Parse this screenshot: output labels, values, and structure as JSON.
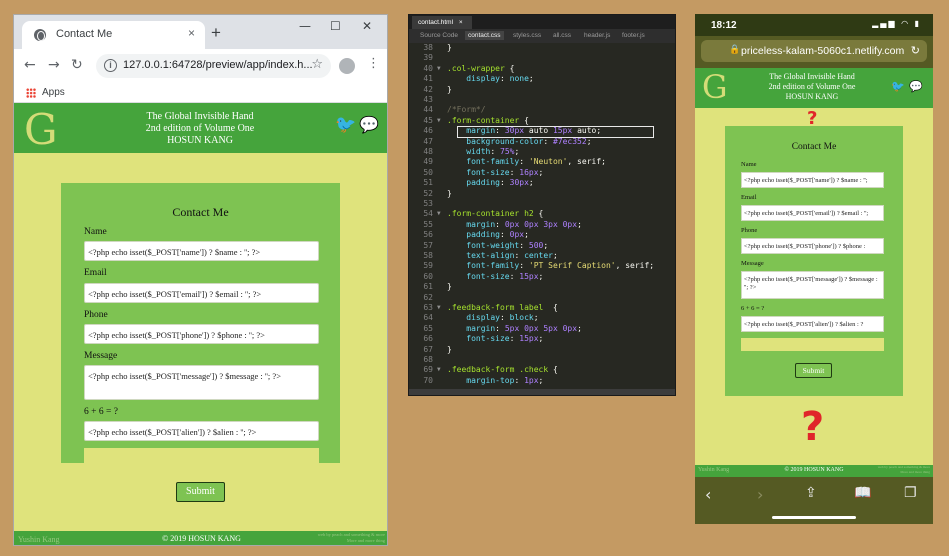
{
  "browser": {
    "tab_title": "Contact Me",
    "tab_close": "×",
    "new_tab": "+",
    "window_controls": [
      "—",
      "☐",
      "✕"
    ],
    "url": "127.0.0.1:64728/preview/app/index.h...",
    "bookmarks_label": "Apps",
    "icons": [
      "globe-icon",
      "back-icon",
      "forward-icon",
      "reload-icon",
      "info-icon",
      "star-icon",
      "avatar-icon",
      "menu-icon",
      "apps-icon"
    ]
  },
  "site": {
    "title_line1": "The Global Invisible Hand",
    "title_line2": "2nd edition of Volume One",
    "title_line3": "HOSUN KANG",
    "logo_letter": "G",
    "form_title": "Contact Me",
    "fields": [
      {
        "label": "Name",
        "value": "<?php echo isset($_POST['name']) ? $name : ''; ?>"
      },
      {
        "label": "Email",
        "value": "<?php echo isset($_POST['email']) ? $email : ''; ?>"
      },
      {
        "label": "Phone",
        "value": "<?php echo isset($_POST['phone']) ? $phone : ''; ?>"
      },
      {
        "label": "Message",
        "value": "<?php echo isset($_POST['message']) ? $message : ''; ?>"
      },
      {
        "label": "6 + 6 = ?",
        "value": "<?php echo isset($_POST['alien']) ? $alien : ''; ?>"
      }
    ],
    "submit_label": "Submit",
    "footer_left": "Yushin Kang",
    "footer_center": "© 2019 HOSUN KANG",
    "footer_right_line1": "web by peach and something & more",
    "footer_right_line2": "More and more thing"
  },
  "editor": {
    "file_tab": "contact.html",
    "file_tab_close": "×",
    "files": [
      "Source Code",
      "contact.css",
      "styles.css",
      "all.css",
      "header.js",
      "footer.js"
    ],
    "active_file": "contact.css",
    "lines": [
      {
        "n": "38",
        "f": "",
        "parts": [
          [
            "pn",
            "}"
          ]
        ]
      },
      {
        "n": "39",
        "f": "",
        "parts": []
      },
      {
        "n": "40",
        "f": "▼",
        "parts": [
          [
            "sel-c",
            ".col-wrapper"
          ],
          [
            "pn",
            " {"
          ]
        ]
      },
      {
        "n": "41",
        "f": "",
        "parts": [
          [
            "prop",
            "    display"
          ],
          [
            "pn",
            ": "
          ],
          [
            "prop",
            "none"
          ],
          [
            "pn",
            ";"
          ]
        ]
      },
      {
        "n": "42",
        "f": "",
        "parts": [
          [
            "pn",
            "}"
          ]
        ]
      },
      {
        "n": "43",
        "f": "",
        "parts": []
      },
      {
        "n": "44",
        "f": "",
        "parts": [
          [
            "cmt",
            "/*Form*/"
          ]
        ]
      },
      {
        "n": "45",
        "f": "▼",
        "parts": [
          [
            "sel-c",
            ".form-container"
          ],
          [
            "pn",
            " {"
          ]
        ]
      },
      {
        "n": "46",
        "f": "",
        "parts": [
          [
            "prop",
            "    margin"
          ],
          [
            "pn",
            ": "
          ],
          [
            "val",
            "30px"
          ],
          [
            "pn",
            " auto "
          ],
          [
            "val",
            "15px"
          ],
          [
            "pn",
            " auto;"
          ]
        ]
      },
      {
        "n": "47",
        "f": "",
        "parts": [
          [
            "prop",
            "    background-color"
          ],
          [
            "pn",
            ": "
          ],
          [
            "val",
            "#7ec352"
          ],
          [
            "pn",
            ";"
          ]
        ]
      },
      {
        "n": "48",
        "f": "",
        "parts": [
          [
            "prop",
            "    width"
          ],
          [
            "pn",
            ": "
          ],
          [
            "val",
            "75%"
          ],
          [
            "pn",
            ";"
          ]
        ]
      },
      {
        "n": "49",
        "f": "",
        "parts": [
          [
            "prop",
            "    font-family"
          ],
          [
            "pn",
            ": "
          ],
          [
            "str",
            "'Neuton'"
          ],
          [
            "pn",
            ", serif;"
          ]
        ]
      },
      {
        "n": "50",
        "f": "",
        "parts": [
          [
            "prop",
            "    font-size"
          ],
          [
            "pn",
            ": "
          ],
          [
            "val",
            "16px"
          ],
          [
            "pn",
            ";"
          ]
        ]
      },
      {
        "n": "51",
        "f": "",
        "parts": [
          [
            "prop",
            "    padding"
          ],
          [
            "pn",
            ": "
          ],
          [
            "val",
            "30px"
          ],
          [
            "pn",
            ";"
          ]
        ]
      },
      {
        "n": "52",
        "f": "",
        "parts": [
          [
            "pn",
            "}"
          ]
        ]
      },
      {
        "n": "53",
        "f": "",
        "parts": []
      },
      {
        "n": "54",
        "f": "▼",
        "parts": [
          [
            "sel-c",
            ".form-container h2"
          ],
          [
            "pn",
            " {"
          ]
        ]
      },
      {
        "n": "55",
        "f": "",
        "parts": [
          [
            "prop",
            "    margin"
          ],
          [
            "pn",
            ": "
          ],
          [
            "val",
            "0px 0px 3px 0px"
          ],
          [
            "pn",
            ";"
          ]
        ]
      },
      {
        "n": "56",
        "f": "",
        "parts": [
          [
            "prop",
            "    padding"
          ],
          [
            "pn",
            ": "
          ],
          [
            "val",
            "0px"
          ],
          [
            "pn",
            ";"
          ]
        ]
      },
      {
        "n": "57",
        "f": "",
        "parts": [
          [
            "prop",
            "    font-weight"
          ],
          [
            "pn",
            ": "
          ],
          [
            "val",
            "500"
          ],
          [
            "pn",
            ";"
          ]
        ]
      },
      {
        "n": "58",
        "f": "",
        "parts": [
          [
            "prop",
            "    text-align"
          ],
          [
            "pn",
            ": "
          ],
          [
            "prop",
            "center"
          ],
          [
            "pn",
            ";"
          ]
        ]
      },
      {
        "n": "59",
        "f": "",
        "parts": [
          [
            "prop",
            "    font-family"
          ],
          [
            "pn",
            ": "
          ],
          [
            "str",
            "'PT Serif Caption'"
          ],
          [
            "pn",
            ", serif;"
          ]
        ]
      },
      {
        "n": "60",
        "f": "",
        "parts": [
          [
            "prop",
            "    font-size"
          ],
          [
            "pn",
            ": "
          ],
          [
            "val",
            "15px"
          ],
          [
            "pn",
            ";"
          ]
        ]
      },
      {
        "n": "61",
        "f": "",
        "parts": [
          [
            "pn",
            "}"
          ]
        ]
      },
      {
        "n": "62",
        "f": "",
        "parts": []
      },
      {
        "n": "63",
        "f": "▼",
        "parts": [
          [
            "sel-c",
            ".feedback-form label"
          ],
          [
            "pn",
            "  {"
          ]
        ]
      },
      {
        "n": "64",
        "f": "",
        "parts": [
          [
            "prop",
            "    display"
          ],
          [
            "pn",
            ": "
          ],
          [
            "prop",
            "block"
          ],
          [
            "pn",
            ";"
          ]
        ]
      },
      {
        "n": "65",
        "f": "",
        "parts": [
          [
            "prop",
            "    margin"
          ],
          [
            "pn",
            ": "
          ],
          [
            "val",
            "5px 0px 5px 0px"
          ],
          [
            "pn",
            ";"
          ]
        ]
      },
      {
        "n": "66",
        "f": "",
        "parts": [
          [
            "prop",
            "    font-size"
          ],
          [
            "pn",
            ": "
          ],
          [
            "val",
            "15px"
          ],
          [
            "pn",
            ";"
          ]
        ]
      },
      {
        "n": "67",
        "f": "",
        "parts": [
          [
            "pn",
            "}"
          ]
        ]
      },
      {
        "n": "68",
        "f": "",
        "parts": []
      },
      {
        "n": "69",
        "f": "▼",
        "parts": [
          [
            "sel-c",
            ".feedback-form .check"
          ],
          [
            "pn",
            " {"
          ]
        ]
      },
      {
        "n": "70",
        "f": "",
        "parts": [
          [
            "prop",
            "    margin-top"
          ],
          [
            "pn",
            ": "
          ],
          [
            "val",
            "1px"
          ],
          [
            "pn",
            ";"
          ]
        ]
      }
    ]
  },
  "phone": {
    "time": "18:12",
    "status_icons": "▂▄▆ ◠ ▮",
    "url": "priceless-kalam-5060c1.netlify.com",
    "question_mark": "?",
    "field_values": [
      "<?php echo isset($_POST['name']) ? $name : '';",
      "<?php echo isset($_POST['email']) ? $email : '';",
      "<?php echo isset($_POST['phone']) ? $phone :",
      "<?php echo isset($_POST['message']) ? $message : ''; ?>",
      "<?php echo isset($_POST['alien']) ? $alien : ?"
    ],
    "alien_label": "6 + 6 = ?"
  }
}
